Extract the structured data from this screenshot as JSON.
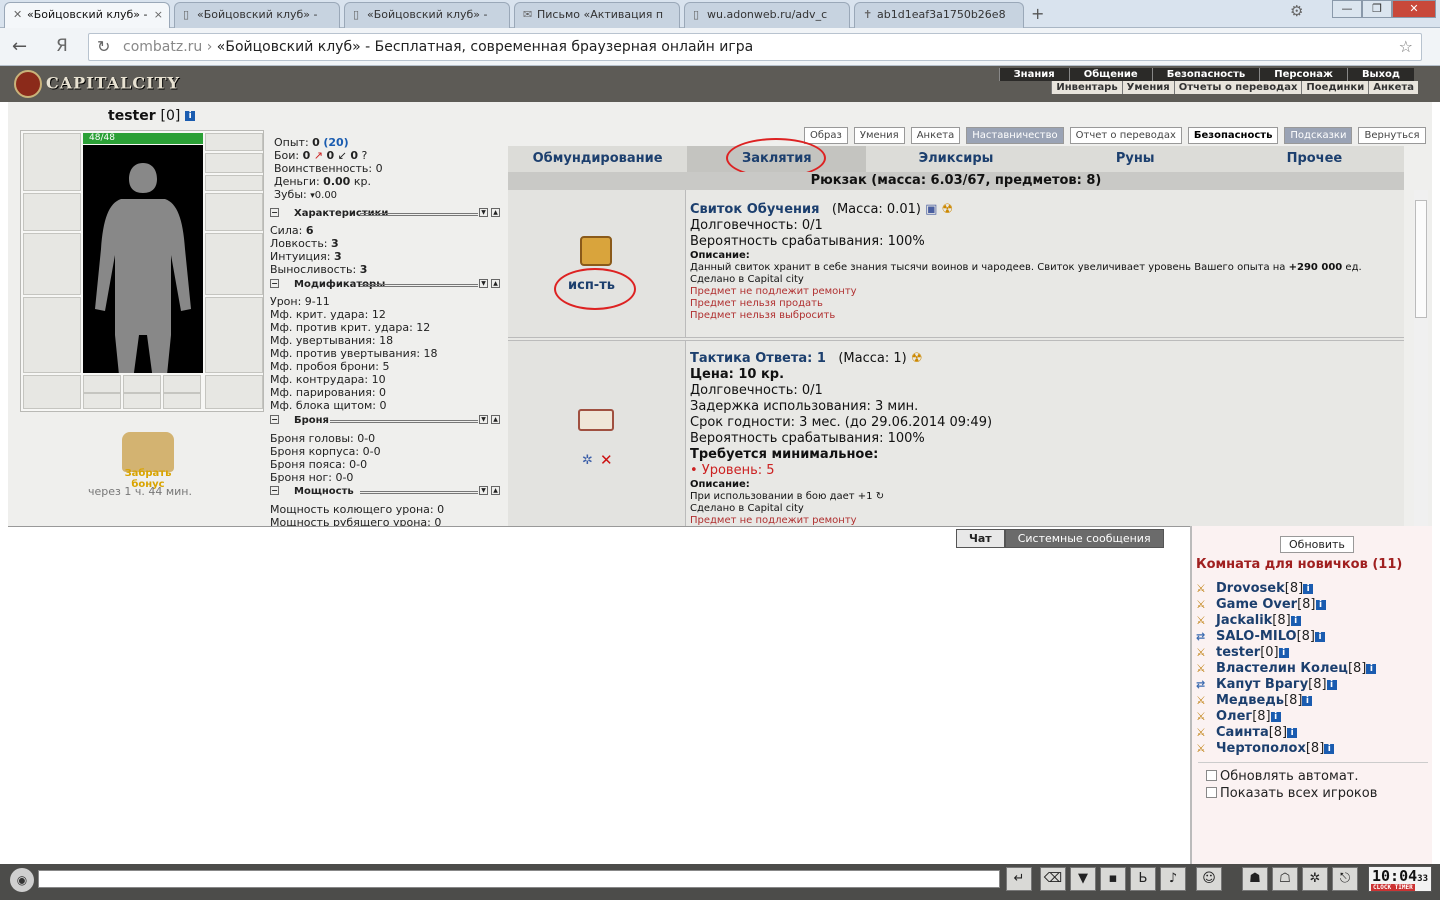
{
  "browser": {
    "tabs": [
      {
        "title": "«Бойцовский клуб» -",
        "active": true
      },
      {
        "title": "«Бойцовский клуб» -",
        "active": false
      },
      {
        "title": "«Бойцовский клуб» -",
        "active": false
      },
      {
        "title": "Письмо «Активация п",
        "active": false
      },
      {
        "title": "wu.adonweb.ru/adv_c",
        "active": false
      },
      {
        "title": "ab1d1eaf3a1750b26e8",
        "active": false
      }
    ],
    "url_domain": "combatz.ru",
    "url_sep": " › ",
    "url_title": "«Бойцовский клуб» - Бесплатная, современная браузерная онлайн игра",
    "ya": "Я"
  },
  "game": {
    "logo": "CAPITALCITY",
    "menu": [
      "Знания",
      "Общение",
      "Безопасность",
      "Персонаж",
      "Выход"
    ],
    "submenu": [
      "Инвентарь",
      "Умения",
      "Отчеты о переводах",
      "Поединки",
      "Анкета"
    ]
  },
  "character": {
    "name": "tester",
    "level": "[0]",
    "hp": "48/48",
    "bonus_label": "Забрать бонус",
    "bonus_time": "через 1 ч. 44 мин."
  },
  "stats": {
    "exp_label": "Опыт:",
    "exp": "0",
    "exp_next": "(20)",
    "fights_label": "Бои:",
    "wins": "0",
    "losses": "0",
    "draws": "0",
    "valor_label": "Воинственность:",
    "valor": "0",
    "money_label": "Деньги:",
    "money": "0.00",
    "money_unit": "кр.",
    "teeth_label": "Зубы:",
    "teeth": "0.00",
    "sections": {
      "chars": "Характеристики",
      "mods": "Модификаторы",
      "armor": "Броня",
      "power": "Мощность"
    },
    "chars": [
      {
        "label": "Сила:",
        "value": "6"
      },
      {
        "label": "Ловкость:",
        "value": "3"
      },
      {
        "label": "Интуиция:",
        "value": "3"
      },
      {
        "label": "Выносливость:",
        "value": "3"
      }
    ],
    "mods": [
      "Урон: 9-11",
      "Мф. крит. удара: 12",
      "Мф. против крит. удара: 12",
      "Мф. увертывания: 18",
      "Мф. против увертывания: 18",
      "Мф. пробоя брони: 5",
      "Мф. контрудара: 10",
      "Мф. парирования: 0",
      "Мф. блока щитом: 0"
    ],
    "armor": [
      "Броня головы: 0-0",
      "Броня корпуса: 0-0",
      "Броня пояса: 0-0",
      "Броня ног: 0-0"
    ],
    "power": [
      "Мощность колющего урона: 0",
      "Мощность рубящего урона: 0"
    ]
  },
  "subtabs": [
    "Образ",
    "Умения",
    "Анкета",
    "Наставничество",
    "Отчет о переводах",
    "Безопасность",
    "Подсказки",
    "Вернуться"
  ],
  "invtabs": [
    "Обмундирование",
    "Заклятия",
    "Эликсиры",
    "Руны",
    "Прочее"
  ],
  "rucksack": "Рюкзак (масса: 6.03/67, предметов: 8)",
  "items": [
    {
      "use_label": "исп-ть",
      "name": "Свиток Обучения",
      "mass": "(Масса: 0.01)",
      "durability": "Долговечность: 0/1",
      "chance": "Вероятность срабатывания: 100%",
      "desc_label": "Описание:",
      "desc": "Данный свиток хранит в себе знания тысячи воинов и чародеев. Свиток увеличивает уровень Вашего опыта на",
      "desc_bonus": "+290 000",
      "desc_tail": "ед.",
      "made": "Сделано в Capital city",
      "notes": [
        "Предмет не подлежит ремонту",
        "Предмет нельзя продать",
        "Предмет нельзя выбросить"
      ]
    },
    {
      "name": "Тактика Ответа: 1",
      "mass": "(Масса: 1)",
      "price": "Цена: 10 кр.",
      "durability": "Долговечность: 0/1",
      "delay": "Задержка использования: 3 мин.",
      "expiry": "Срок годности: 3 мес. (до 29.06.2014 09:49)",
      "chance": "Вероятность срабатывания: 100%",
      "req_label": "Требуется минимальное:",
      "req": "• Уровень: 5",
      "desc_label": "Описание:",
      "desc": "При использовании в бою дает +1",
      "made": "Сделано в Capital city",
      "notes": [
        "Предмет не подлежит ремонту"
      ]
    }
  ],
  "chat": {
    "tab1": "Чат",
    "tab2": "Системные сообщения"
  },
  "room": {
    "refresh": "Обновить",
    "title": "Комната для новичков (11)",
    "players": [
      {
        "name": "Drovosek",
        "level": "[8]"
      },
      {
        "name": "Game Over",
        "level": "[8]"
      },
      {
        "name": "Jackalik",
        "level": "[8]"
      },
      {
        "name": "SALO-MILO",
        "level": "[8]"
      },
      {
        "name": "tester",
        "level": "[0]"
      },
      {
        "name": "Властелин Колец",
        "level": "[8]"
      },
      {
        "name": "Капут Врагу",
        "level": "[8]"
      },
      {
        "name": "Медведь",
        "level": "[8]"
      },
      {
        "name": "Олег",
        "level": "[8]"
      },
      {
        "name": "Саинта",
        "level": "[8]"
      },
      {
        "name": "Чертополох",
        "level": "[8]"
      }
    ],
    "auto": "Обновлять автомат.",
    "showall": "Показать всех игроков"
  },
  "clock": {
    "time": "10:04",
    "sec": "33",
    "label": "CLOCK TIMER"
  }
}
